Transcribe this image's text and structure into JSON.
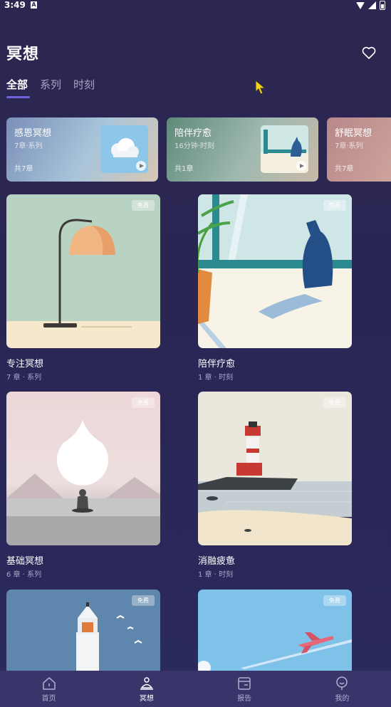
{
  "status": {
    "time": "3:49",
    "notif_icon": "A"
  },
  "page": {
    "title": "冥想"
  },
  "tabs": [
    {
      "label": "全部",
      "active": true
    },
    {
      "label": "系列",
      "active": false
    },
    {
      "label": "时刻",
      "active": false
    }
  ],
  "series": [
    {
      "title": "感恩冥想",
      "sub": "7章·系列",
      "count": "共7章"
    },
    {
      "title": "陪伴疗愈",
      "sub": "16分钟·时刻",
      "count": "共1章"
    },
    {
      "title": "舒眠冥想",
      "sub": "7章·系列",
      "count": "共7章"
    }
  ],
  "free_label": "免费",
  "cards": [
    {
      "title": "专注冥想",
      "sub": "7 章 · 系列"
    },
    {
      "title": "陪伴疗愈",
      "sub": "1 章 · 时刻"
    },
    {
      "title": "基础冥想",
      "sub": "6 章 · 系列"
    },
    {
      "title": "消融疲惫",
      "sub": "1 章 · 时刻"
    }
  ],
  "nav": [
    {
      "label": "首页",
      "icon": "home-icon"
    },
    {
      "label": "冥想",
      "icon": "meditation-icon",
      "active": true
    },
    {
      "label": "报告",
      "icon": "report-icon"
    },
    {
      "label": "我的",
      "icon": "profile-icon"
    }
  ],
  "colors": {
    "accent": "#6e62d8",
    "nav_bg": "#39346a"
  }
}
